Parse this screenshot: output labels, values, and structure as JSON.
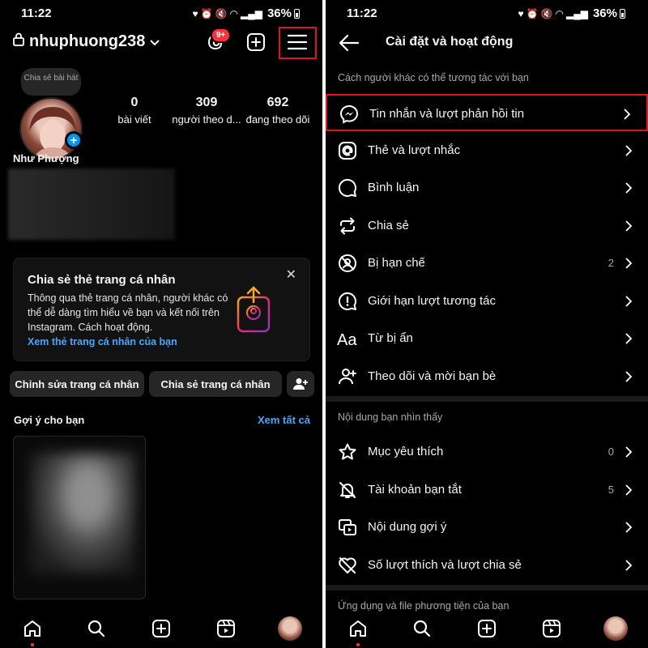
{
  "status_bar": {
    "time": "11:22",
    "battery": "36%",
    "net": "VoLTE1"
  },
  "profile": {
    "username": "nhuphuong238",
    "notification_badge": "9+",
    "note": "Chia sẻ bài hát",
    "display_name": "Như Phượng",
    "stats": [
      {
        "value": "0",
        "label": "bài viết"
      },
      {
        "value": "309",
        "label": "người theo d..."
      },
      {
        "value": "692",
        "label": "đang theo dõi"
      }
    ],
    "share_card": {
      "title": "Chia sẻ thẻ trang cá nhân",
      "description": "Thông qua thẻ trang cá nhân, người khác có thể dễ dàng tìm hiểu về bạn và kết nối trên Instagram. Cách hoạt động.",
      "link": "Xem thẻ trang cá nhân của bạn",
      "close": "✕"
    },
    "buttons": {
      "edit": "Chỉnh sửa trang cá nhân",
      "share": "Chia sẻ trang cá nhân"
    },
    "suggestions": {
      "title": "Gợi ý cho bạn",
      "see_all": "Xem tất cả"
    }
  },
  "settings": {
    "title": "Cài đặt và hoạt động",
    "sections": [
      {
        "header": "Cách người khác có thể tương tác với bạn",
        "items": [
          {
            "label": "Tin nhắn và lượt phản hồi tin",
            "icon": "messenger-icon",
            "count": "",
            "highlighted": true
          },
          {
            "label": "Thẻ và lượt nhắc",
            "icon": "at-sign-icon",
            "count": ""
          },
          {
            "label": "Bình luận",
            "icon": "comment-icon",
            "count": ""
          },
          {
            "label": "Chia sẻ",
            "icon": "repost-icon",
            "count": ""
          },
          {
            "label": "Bị hạn chế",
            "icon": "restricted-icon",
            "count": "2"
          },
          {
            "label": "Giới hạn lượt tương tác",
            "icon": "alert-circle-icon",
            "count": ""
          },
          {
            "label": "Từ bị ẩn",
            "icon": "font-aa-icon",
            "count": ""
          },
          {
            "label": "Theo dõi và mời bạn bè",
            "icon": "add-person-icon",
            "count": ""
          }
        ]
      },
      {
        "header": "Nội dung bạn nhìn thấy",
        "items": [
          {
            "label": "Mục yêu thích",
            "icon": "star-icon",
            "count": "0"
          },
          {
            "label": "Tài khoản bạn tắt",
            "icon": "muted-bell-icon",
            "count": "5"
          },
          {
            "label": "Nội dung gợi ý",
            "icon": "suggested-content-icon",
            "count": ""
          },
          {
            "label": "Số lượt thích và lượt chia sẻ",
            "icon": "heart-off-icon",
            "count": ""
          }
        ]
      },
      {
        "header": "Ứng dụng và file phương tiện của bạn",
        "items": []
      }
    ]
  },
  "colors": {
    "background": "#000000",
    "accent_blue": "#0095f6",
    "highlight_red": "#e0141e",
    "muted_text": "#a8a8a8"
  }
}
